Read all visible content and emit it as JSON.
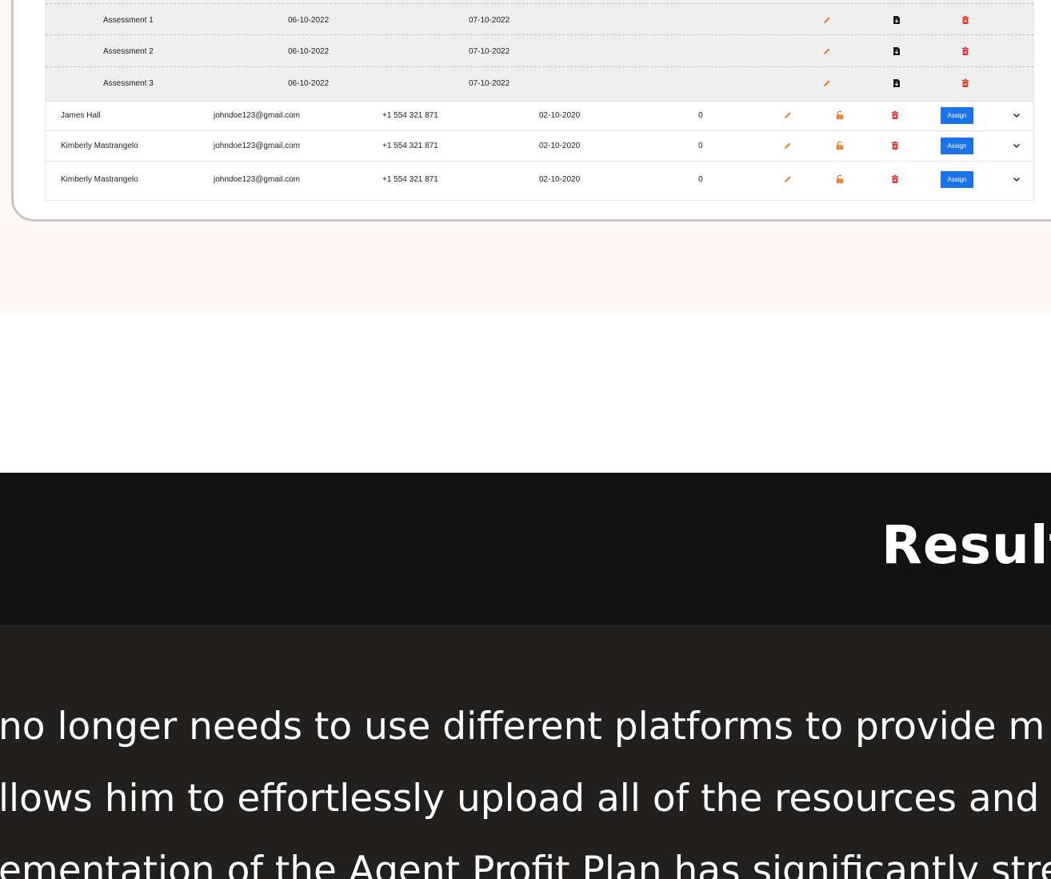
{
  "sub_rows": [
    {
      "name": "Assessment 1",
      "start": "06-10-2022",
      "end": "07-10-2022"
    },
    {
      "name": "Assessment 2",
      "start": "06-10-2022",
      "end": "07-10-2022"
    },
    {
      "name": "Assessment 3",
      "start": "06-10-2022",
      "end": "07-10-2022"
    }
  ],
  "rows": [
    {
      "name": "James Hall",
      "email": "johndoe123@gmail.com",
      "phone": "+1 554 321 871",
      "date": "02-10-2020",
      "count": "0",
      "assign_label": "Assign"
    },
    {
      "name": "Kimberly Mastrangelo",
      "email": "johndoe123@gmail.com",
      "phone": "+1 554 321 871",
      "date": "02-10-2020",
      "count": "0",
      "assign_label": "Assign"
    },
    {
      "name": "Kimberly Mastrangelo",
      "email": "johndoe123@gmail.com",
      "phone": "+1 554 321 871",
      "date": "02-10-2020",
      "count": "0",
      "assign_label": "Assign"
    }
  ],
  "colors": {
    "accent_blue": "#1a73e8",
    "edit_orange": "#f47b20",
    "delete_red": "#e53935",
    "section_peach": "#fff8f4",
    "dark_band": "#121212",
    "text_band": "#221f1f"
  },
  "results": {
    "title": "Result",
    "lines": [
      "no longer needs to use different platforms to provide m",
      "llows him to effortlessly upload all of the resources and",
      "ementation of the Agent Profit Plan has significantly stre"
    ]
  }
}
